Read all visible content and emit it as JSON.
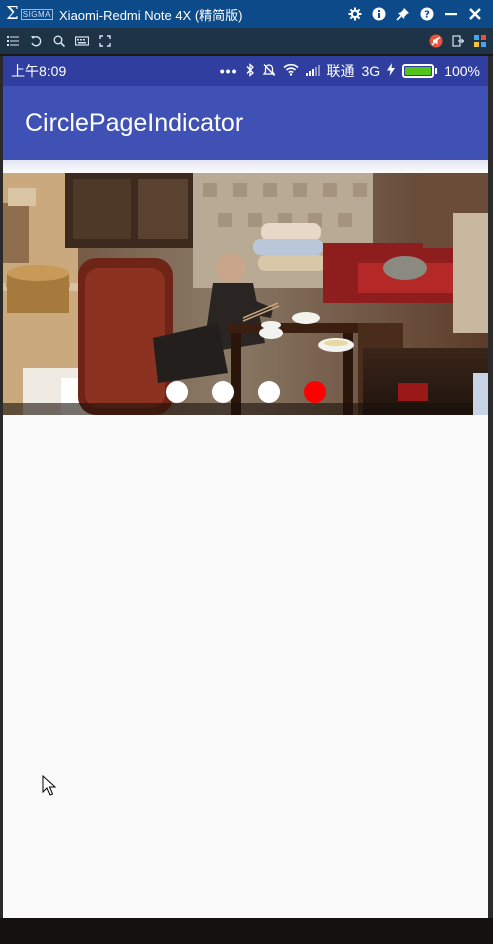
{
  "window": {
    "logo_brand": "SIGMA",
    "title": "Xiaomi-Redmi Note 4X (精简版)",
    "controls": [
      "settings-icon",
      "info-icon",
      "pin-icon",
      "help-icon",
      "minimize-icon",
      "close-icon"
    ]
  },
  "toolbar": {
    "left_icons": [
      "list-icon",
      "rotate-icon",
      "zoom-icon",
      "keyboard-icon",
      "fullscreen-icon"
    ],
    "right_icons": [
      "mute-icon",
      "exit-icon",
      "apps-icon"
    ]
  },
  "statusbar": {
    "time": "上午8:09",
    "carrier": "联通",
    "network": "3G",
    "battery": "100%",
    "battery_level": 100
  },
  "appbar": {
    "title": "CirclePageIndicator"
  },
  "pager": {
    "page_count": 4,
    "current_page": 4
  },
  "colors": {
    "statusbar": "#303f9f",
    "appbar": "#3f51b5",
    "indicator_active": "#ff0000",
    "indicator_inactive": "#ffffff"
  }
}
